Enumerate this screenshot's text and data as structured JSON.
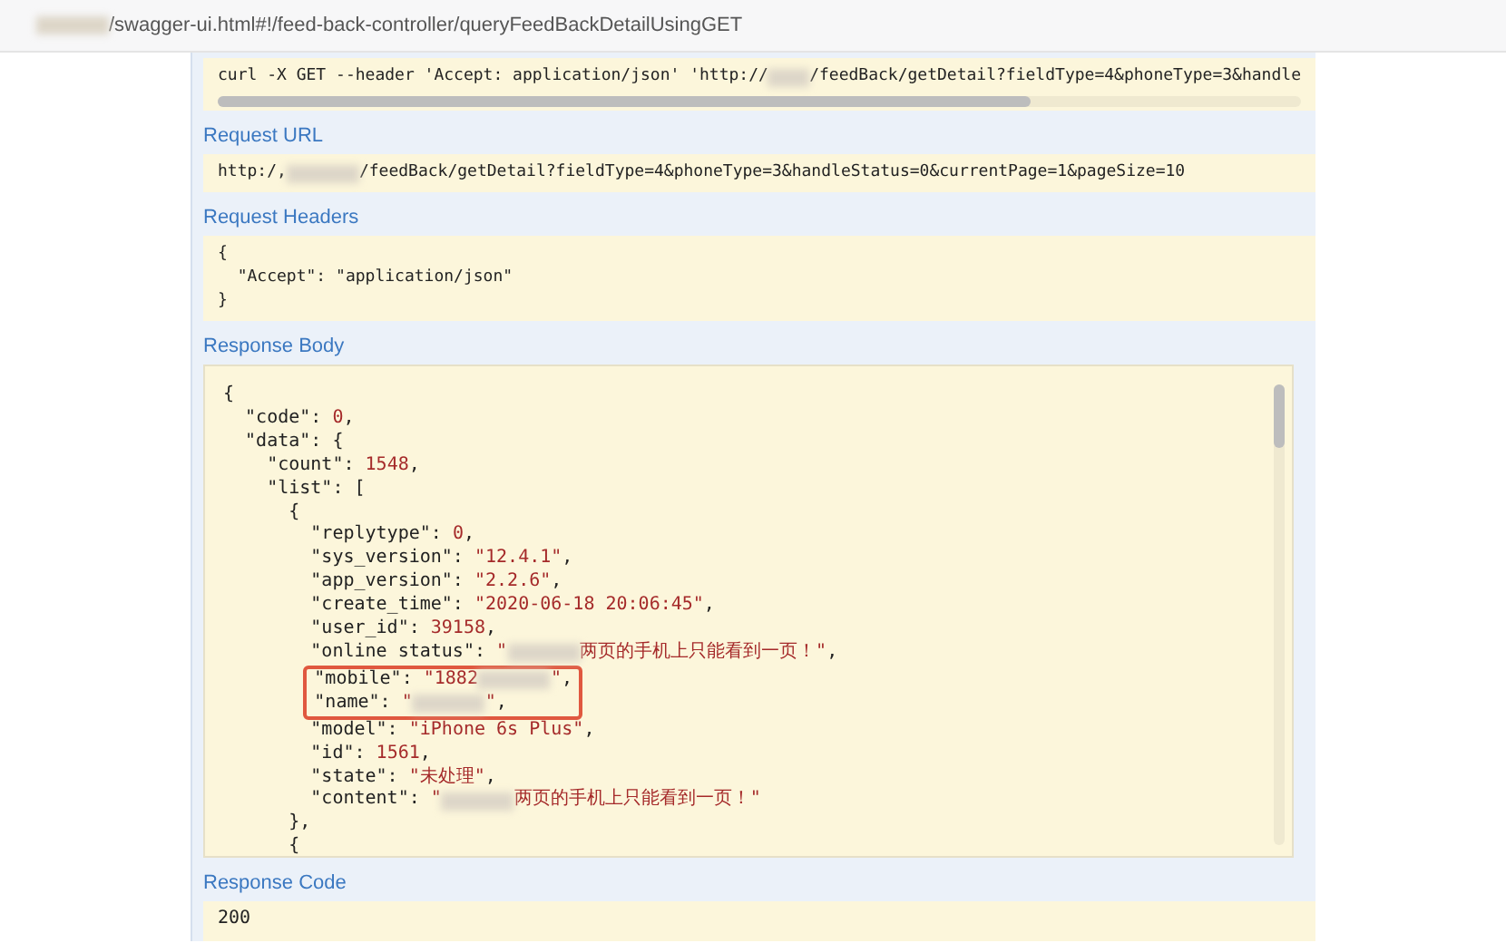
{
  "address_bar": {
    "url": [
      {
        "kind": "blur"
      },
      {
        "kind": "plain",
        "text": "/swagger-ui.html#!/feed-back-controller/queryFeedBackDetailUsingGET"
      }
    ]
  },
  "curl": {
    "parts": [
      {
        "kind": "plain",
        "text": "curl -X GET --header 'Accept: application/json' 'http://"
      },
      {
        "kind": "blur"
      },
      {
        "kind": "plain",
        "text": "/feedBack/getDetail?fieldType=4&phoneType=3&handle"
      }
    ]
  },
  "request_url": {
    "label": "Request URL",
    "parts": [
      {
        "kind": "plain",
        "text": "http:/,"
      },
      {
        "kind": "blur"
      },
      {
        "kind": "plain",
        "text": "/feedBack/getDetail?fieldType=4&phoneType=3&handleStatus=0&currentPage=1&pageSize=10"
      }
    ]
  },
  "request_headers": {
    "label": "Request Headers",
    "lines": [
      "{",
      "  \"Accept\": \"application/json\"",
      "}"
    ]
  },
  "response_body": {
    "label": "Response Body",
    "blocks": [
      {
        "highlighted": false,
        "lines": [
          [
            {
              "kind": "plain",
              "text": "{"
            }
          ],
          [
            {
              "kind": "plain",
              "text": "  \"code\": "
            },
            {
              "kind": "value",
              "text": "0"
            },
            {
              "kind": "plain",
              "text": ","
            }
          ],
          [
            {
              "kind": "plain",
              "text": "  \"data\": {"
            }
          ],
          [
            {
              "kind": "plain",
              "text": "    \"count\": "
            },
            {
              "kind": "value",
              "text": "1548"
            },
            {
              "kind": "plain",
              "text": ","
            }
          ],
          [
            {
              "kind": "plain",
              "text": "    \"list\": ["
            }
          ],
          [
            {
              "kind": "plain",
              "text": "      {"
            }
          ],
          [
            {
              "kind": "plain",
              "text": "        \"replytype\": "
            },
            {
              "kind": "value",
              "text": "0"
            },
            {
              "kind": "plain",
              "text": ","
            }
          ],
          [
            {
              "kind": "plain",
              "text": "        \"sys_version\": "
            },
            {
              "kind": "value",
              "text": "\"12.4.1\""
            },
            {
              "kind": "plain",
              "text": ","
            }
          ],
          [
            {
              "kind": "plain",
              "text": "        \"app_version\": "
            },
            {
              "kind": "value",
              "text": "\"2.2.6\""
            },
            {
              "kind": "plain",
              "text": ","
            }
          ],
          [
            {
              "kind": "plain",
              "text": "        \"create_time\": "
            },
            {
              "kind": "value",
              "text": "\"2020-06-18 20:06:45\""
            },
            {
              "kind": "plain",
              "text": ","
            }
          ],
          [
            {
              "kind": "plain",
              "text": "        \"user_id\": "
            },
            {
              "kind": "value",
              "text": "39158"
            },
            {
              "kind": "plain",
              "text": ","
            }
          ],
          [
            {
              "kind": "plain",
              "text": "        \"online status\": "
            },
            {
              "kind": "value",
              "text": "\""
            },
            {
              "kind": "blur"
            },
            {
              "kind": "value",
              "text": "两页的手机上只能看到一页！\""
            },
            {
              "kind": "plain",
              "text": ","
            }
          ]
        ]
      },
      {
        "highlighted": true,
        "lines": [
          [
            {
              "kind": "plain",
              "text": "        \"mobile\": "
            },
            {
              "kind": "value",
              "text": "\"1882"
            },
            {
              "kind": "blur"
            },
            {
              "kind": "value",
              "text": "\""
            },
            {
              "kind": "plain",
              "text": ","
            }
          ],
          [
            {
              "kind": "plain",
              "text": "        \"name\": "
            },
            {
              "kind": "value",
              "text": "\""
            },
            {
              "kind": "blur"
            },
            {
              "kind": "value",
              "text": "\""
            },
            {
              "kind": "plain",
              "text": ","
            }
          ]
        ]
      },
      {
        "highlighted": false,
        "lines": [
          [
            {
              "kind": "plain",
              "text": "        \"model\": "
            },
            {
              "kind": "value",
              "text": "\"iPhone 6s Plus\""
            },
            {
              "kind": "plain",
              "text": ","
            }
          ],
          [
            {
              "kind": "plain",
              "text": "        \"id\": "
            },
            {
              "kind": "value",
              "text": "1561"
            },
            {
              "kind": "plain",
              "text": ","
            }
          ],
          [
            {
              "kind": "plain",
              "text": "        \"state\": "
            },
            {
              "kind": "value",
              "text": "\"未处理\""
            },
            {
              "kind": "plain",
              "text": ","
            }
          ],
          [
            {
              "kind": "plain",
              "text": "        \"content\": "
            },
            {
              "kind": "value",
              "text": "\""
            },
            {
              "kind": "blur"
            },
            {
              "kind": "value",
              "text": "两页的手机上只能看到一页！\""
            }
          ],
          [
            {
              "kind": "plain",
              "text": "      },"
            }
          ],
          [
            {
              "kind": "plain",
              "text": "      {"
            }
          ]
        ]
      }
    ]
  },
  "response_code": {
    "label": "Response Code",
    "value": "200"
  }
}
